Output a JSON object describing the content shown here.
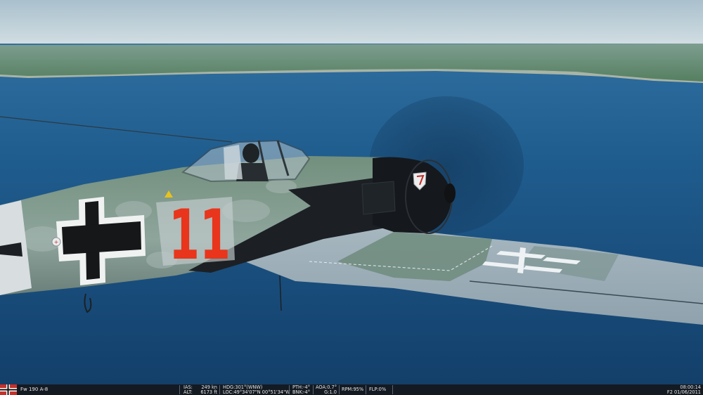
{
  "hud": {
    "aircraft": "Fw 190 A-8",
    "ias_label": "IAS:",
    "ias_value": "249 kn",
    "alt_label": "ALT:",
    "alt_value": "6173 ft",
    "hdg_label": "HDG:",
    "hdg_value": "301°(WNW)",
    "loc_label": "LOC:",
    "loc_value": "49°34'07\"N 00°51'34\"W",
    "pth_label": "PTH:",
    "pth_value": "-4°",
    "bnk_label": "BNK:",
    "bnk_value": "-4°",
    "aoa_label": "AOA:",
    "aoa_value": "0.7°",
    "g_label": "G:",
    "g_value": "1.0",
    "rpm_label": "RPM:",
    "rpm_value": "95%",
    "flp_label": "FLP:",
    "flp_value": "0%",
    "time": "08:00:14",
    "date": "F2 01/06/2011"
  },
  "aircraft_markings": {
    "number": "11"
  },
  "colors": {
    "sky": "#c4d4dc",
    "sea": "#1f5a8c",
    "land": "#5f8f6a",
    "fuselage": "#7c9a8c",
    "cowling": "#15181c",
    "numeral": "#e8351c"
  }
}
